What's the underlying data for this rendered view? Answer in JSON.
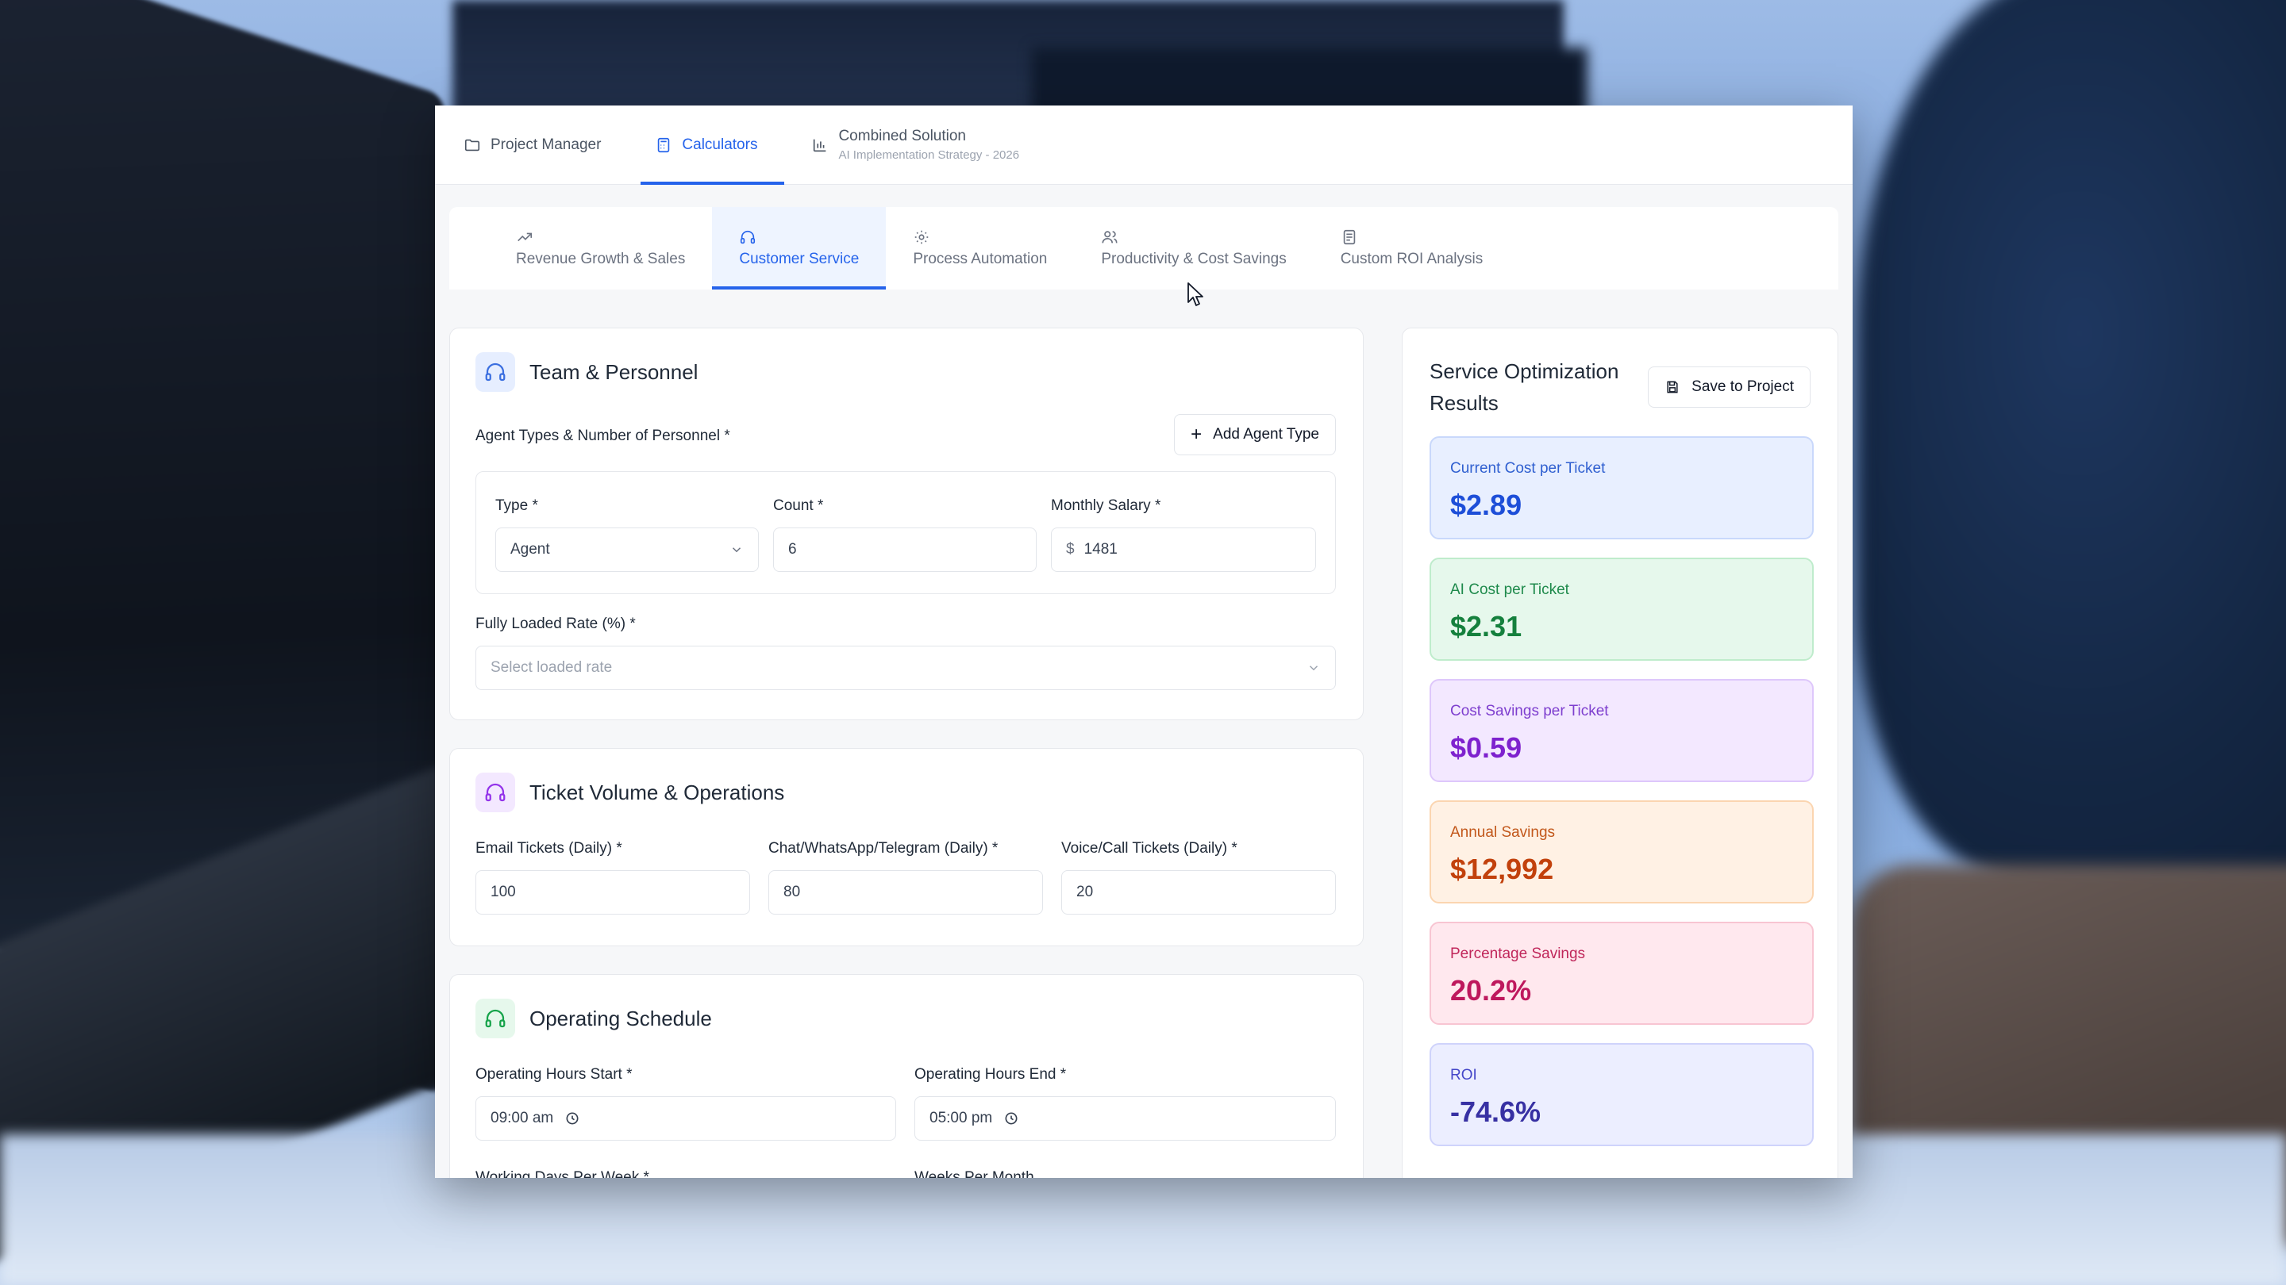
{
  "top_nav": {
    "project_manager": "Project Manager",
    "calculators": "Calculators",
    "combined_title": "Combined Solution",
    "combined_subtitle": "AI Implementation Strategy - 2026"
  },
  "sub_tabs": [
    {
      "label": "Revenue Growth & Sales",
      "icon": "trend-up-icon"
    },
    {
      "label": "Customer Service",
      "icon": "headphones-icon",
      "active": true
    },
    {
      "label": "Process Automation",
      "icon": "gear-icon"
    },
    {
      "label": "Productivity & Cost Savings",
      "icon": "users-icon"
    },
    {
      "label": "Custom ROI Analysis",
      "icon": "document-icon"
    }
  ],
  "team": {
    "title": "Team & Personnel",
    "agent_types_label": "Agent Types & Number of Personnel *",
    "add_agent_button": "Add Agent Type",
    "type_label": "Type *",
    "type_value": "Agent",
    "count_label": "Count *",
    "count_value": "6",
    "salary_label": "Monthly Salary *",
    "salary_prefix": "$",
    "salary_value": "1481",
    "loaded_rate_label": "Fully Loaded Rate (%) *",
    "loaded_rate_placeholder": "Select loaded rate"
  },
  "tickets": {
    "title": "Ticket Volume & Operations",
    "email_label": "Email Tickets (Daily) *",
    "email_value": "100",
    "chat_label": "Chat/WhatsApp/Telegram (Daily) *",
    "chat_value": "80",
    "voice_label": "Voice/Call Tickets (Daily) *",
    "voice_value": "20"
  },
  "schedule": {
    "title": "Operating Schedule",
    "start_label": "Operating Hours Start *",
    "start_value": "09:00 am",
    "end_label": "Operating Hours End *",
    "end_value": "05:00 pm",
    "days_label": "Working Days Per Week *",
    "weeks_label": "Weeks Per Month"
  },
  "results": {
    "title_line1": "Service Optimization",
    "title_line2": "Results",
    "save_button": "Save to Project",
    "items": [
      {
        "label": "Current Cost per Ticket",
        "value": "$2.89",
        "bg": "#e8efff",
        "border": "#c9d8fb",
        "label_color": "#2f5fd0",
        "value_color": "#1d4ed8"
      },
      {
        "label": "AI Cost per Ticket",
        "value": "$2.31",
        "bg": "#e6f8ec",
        "border": "#bfeccc",
        "label_color": "#1f8a4c",
        "value_color": "#15803d"
      },
      {
        "label": "Cost Savings per Ticket",
        "value": "$0.59",
        "bg": "#f3e8ff",
        "border": "#dec7fb",
        "label_color": "#7e3fcf",
        "value_color": "#7e22ce"
      },
      {
        "label": "Annual Savings",
        "value": "$12,992",
        "bg": "#fff1e4",
        "border": "#fbd5b0",
        "label_color": "#c2571a",
        "value_color": "#c2410c"
      },
      {
        "label": "Percentage Savings",
        "value": "20.2%",
        "bg": "#ffe8ee",
        "border": "#f8c5d2",
        "label_color": "#c0265a",
        "value_color": "#be185d"
      },
      {
        "label": "ROI",
        "value": "-74.6%",
        "bg": "#eceeff",
        "border": "#cfd3fb",
        "label_color": "#4547c9",
        "value_color": "#3730a3"
      }
    ]
  }
}
